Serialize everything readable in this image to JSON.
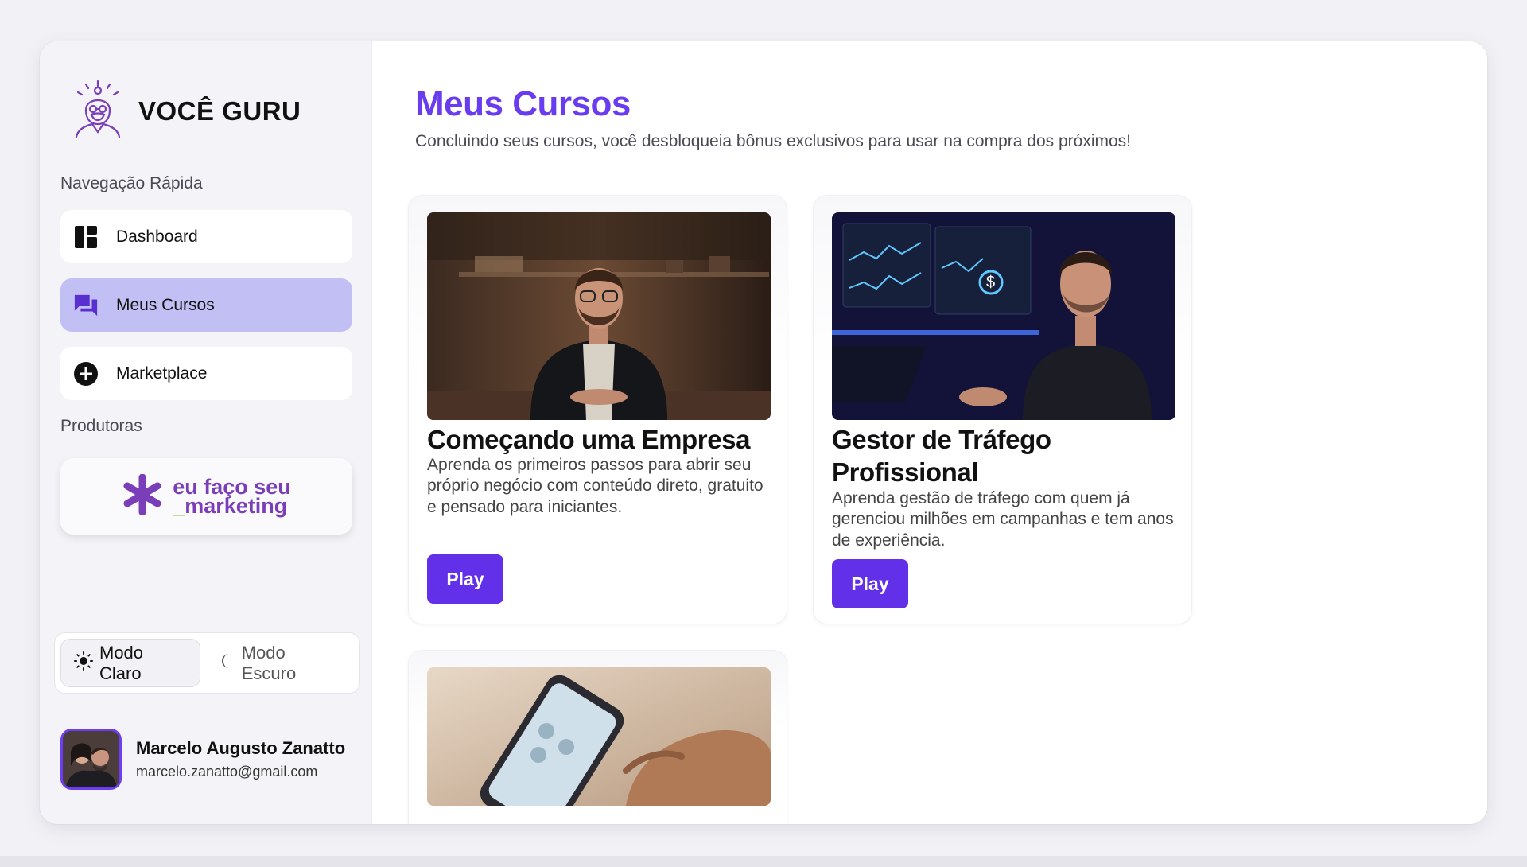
{
  "app": {
    "logo_text": "VOCÊ GURU"
  },
  "sidebar": {
    "quick_nav_label": "Navegação Rápida",
    "items": [
      {
        "label": "Dashboard",
        "icon": "dashboard-icon",
        "active": false
      },
      {
        "label": "Meus Cursos",
        "icon": "chat-bubbles-icon",
        "active": true
      },
      {
        "label": "Marketplace",
        "icon": "plus-circle-icon",
        "active": false
      }
    ],
    "producers_label": "Produtoras",
    "producer": {
      "line1": "eu faço seu",
      "line2": "marketing",
      "underscore": "_"
    },
    "theme": {
      "light": "Modo Claro",
      "dark": "Modo Escuro"
    },
    "user": {
      "name": "Marcelo Augusto Zanatto",
      "email": "marcelo.zanatto@gmail.com"
    }
  },
  "main": {
    "title": "Meus Cursos",
    "subtitle": "Concluindo seus cursos, você desbloqueia bônus exclusivos para usar na compra dos próximos!",
    "courses": [
      {
        "title": "Começando uma Empresa",
        "description": "Aprenda os primeiros passos para abrir seu próprio negócio com conteúdo direto, gratuito e pensado para iniciantes.",
        "button": "Play"
      },
      {
        "title": "Gestor de Tráfego Profissional",
        "description": "Aprenda gestão de tráfego com quem já gerenciou milhões em campanhas e tem anos de experiência.",
        "button": "Play"
      }
    ]
  },
  "colors": {
    "accent": "#6a3cf0",
    "button": "#6130e8",
    "active_nav": "#c2bff4",
    "producer_purple": "#7a3fb8",
    "producer_green": "#8bbd3a"
  }
}
